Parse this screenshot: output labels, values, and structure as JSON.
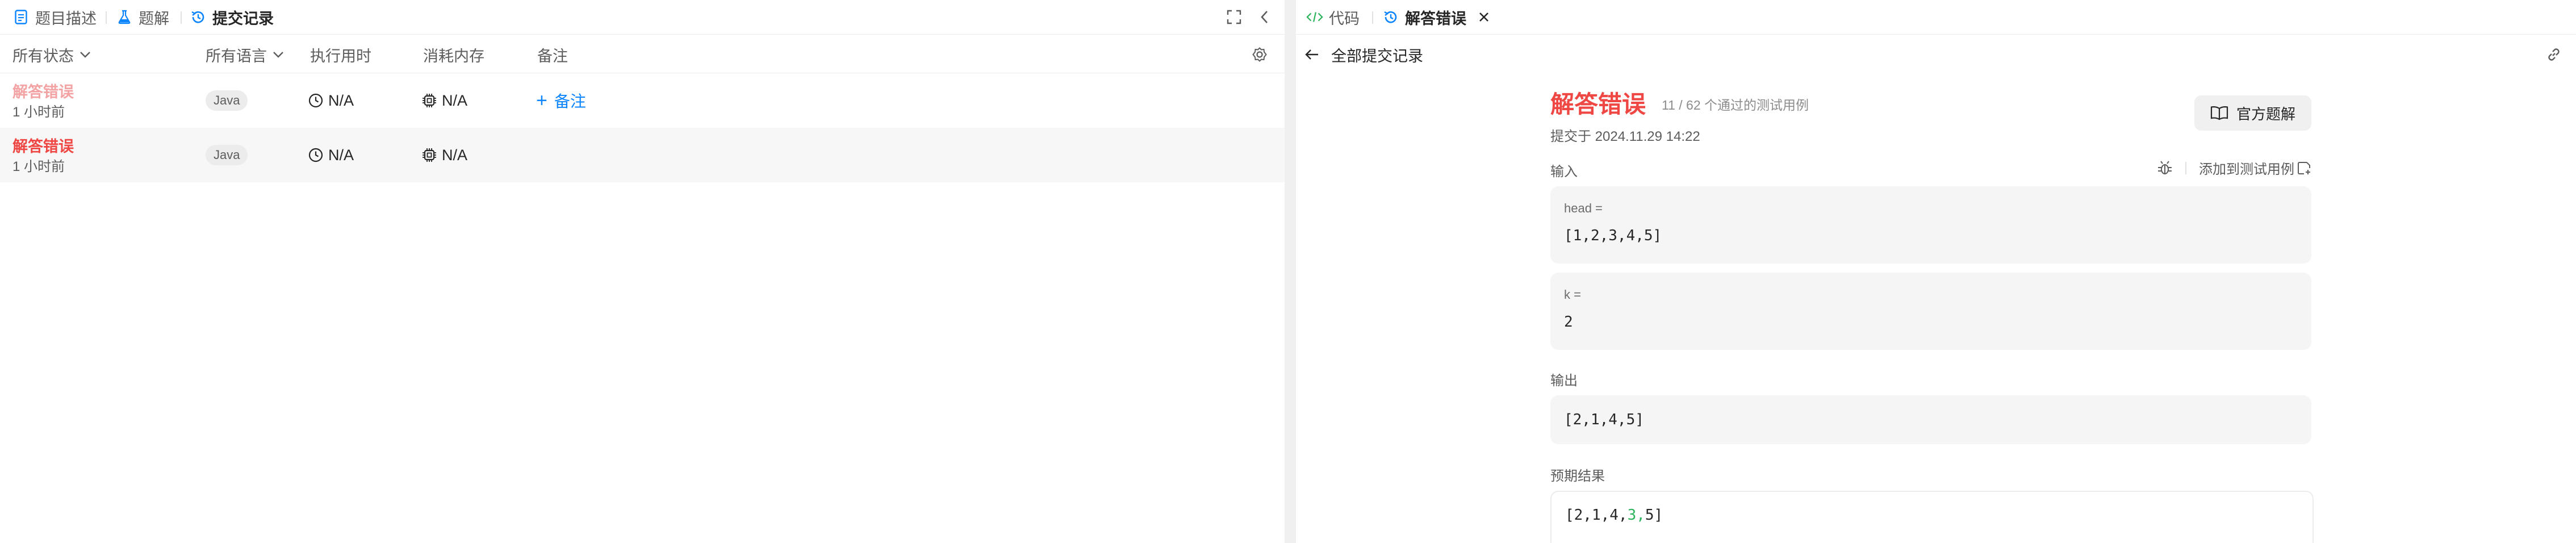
{
  "left": {
    "tabs": [
      {
        "label": "题目描述",
        "icon": "description-icon"
      },
      {
        "label": "题解",
        "icon": "flask-icon"
      },
      {
        "label": "提交记录",
        "icon": "history-icon"
      }
    ],
    "table": {
      "headers": {
        "status": "所有状态",
        "language": "所有语言",
        "runtime": "执行用时",
        "memory": "消耗内存",
        "notes": "备注"
      },
      "rows": [
        {
          "status": "解答错误",
          "time": "1 小时前",
          "language": "Java",
          "runtime": "N/A",
          "memory": "N/A",
          "note_label": "备注"
        },
        {
          "status": "解答错误",
          "time": "1 小时前",
          "language": "Java",
          "runtime": "N/A",
          "memory": "N/A",
          "note_label": ""
        }
      ]
    }
  },
  "right": {
    "tabs": [
      {
        "label": "代码",
        "icon": "code-icon"
      },
      {
        "label": "解答错误",
        "icon": "history-icon"
      }
    ],
    "back_label": "全部提交记录",
    "result": {
      "title": "解答错误",
      "passed_text": "11 / 62 个通过的测试用例",
      "submitted_at": "提交于 2024.11.29 14:22",
      "official_button": "官方题解"
    },
    "input_label": "输入",
    "add_testcase_label": "添加到测试用例",
    "inputs": [
      {
        "name": "head =",
        "value": "[1,2,3,4,5]"
      },
      {
        "name": "k =",
        "value": "2"
      }
    ],
    "output_label": "输出",
    "output_value": "[2,1,4,5]",
    "expected_label": "预期结果",
    "expected_prefix": "[2,1,4,",
    "expected_diff": "3,",
    "expected_suffix": "5]"
  },
  "colors": {
    "error_red": "#ef4743",
    "link_blue": "#0a84ff",
    "diff_green": "#2db55d"
  }
}
